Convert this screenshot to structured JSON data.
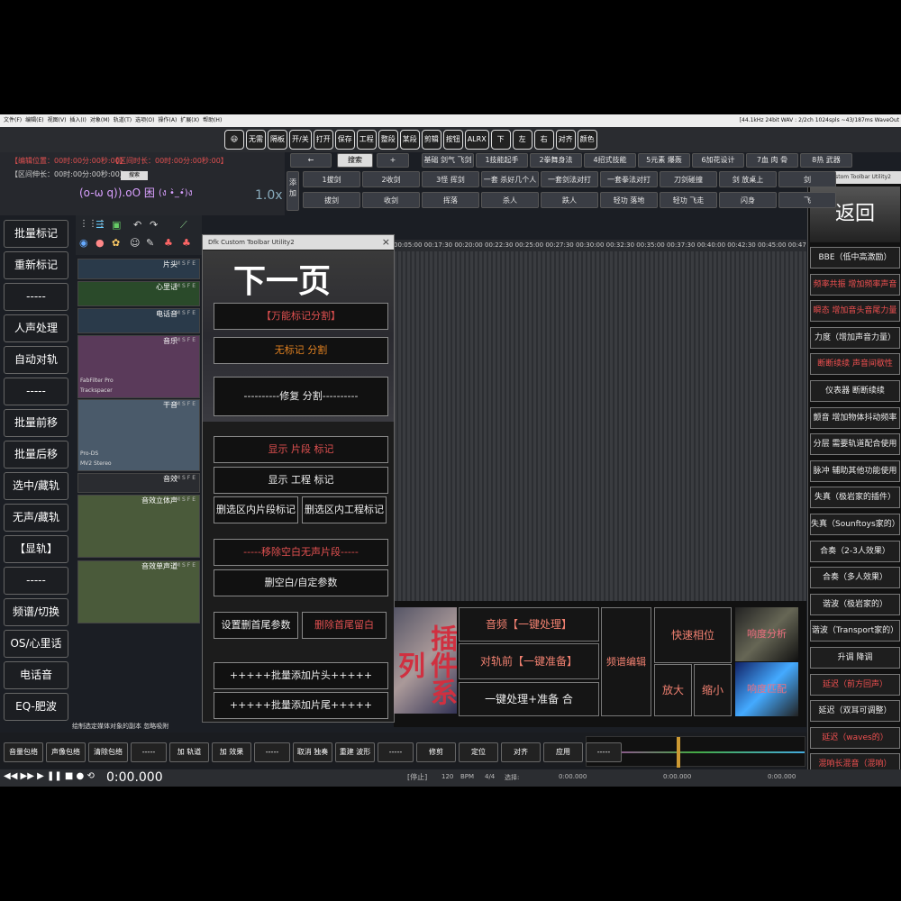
{
  "menu": {
    "items": [
      "文件(F)",
      "编辑(E)",
      "视图(V)",
      "插入(I)",
      "对象(M)",
      "轨道(T)",
      "选项(O)",
      "操作(A)",
      "扩展(X)",
      "帮助(H)"
    ],
    "status": "[44.1kHz 24bit WAV : 2/2ch 1024spls ~43/187ms WaveOut"
  },
  "toolbar": {
    "top_icons": [
      "😃",
      "无需",
      "隔板",
      "开/关",
      "打开",
      "保存",
      "工程",
      "整段",
      "某段",
      "剪辑",
      "按钮",
      "ALRX",
      "下",
      "左",
      "右",
      "对齐",
      "颜色"
    ],
    "back_arrow": "←",
    "search": "搜索",
    "plus": "+",
    "add_label": "添加",
    "zoom": "1.0x"
  },
  "info": {
    "edit_pos": "【编辑位置：00时:00分:00秒:00】",
    "range_len": "【区间时长：00时:00分:00秒:00】",
    "range_start": "【区间伸长：00时:00分:00秒:00】",
    "search_small": "搜索",
    "emote1": "(o-ω q)).oO 困",
    "emote2": "(ง •̀_•́)ง"
  },
  "tags_row1": [
    "基础 剑气 飞剑",
    "1技能起手",
    "2拳舞身法",
    "4招式技能",
    "5元素 爆轰",
    "6加花设计",
    "7血 肉 骨",
    "8热 武器"
  ],
  "tags_row2": [
    "1拔剑",
    "2收剑",
    "3怪 挥剑",
    "一套 杀好几个人",
    "一套剑法对打",
    "一套拳法对打",
    "刀剑碰撞",
    "剑 放桌上",
    "剑"
  ],
  "tags_row3": [
    "拔剑",
    "收剑",
    "挥落",
    "杀人",
    "跌人",
    "轻功 落地",
    "轻功 飞走",
    "闪身",
    "飞"
  ],
  "left_buttons": [
    "批量标记",
    "重新标记",
    "-----",
    "人声处理",
    "自动对轨",
    "-----",
    "批量前移",
    "批量后移",
    "选中/藏轨",
    "无声/藏轨",
    "【显轨】",
    "-----",
    "频谱/切换",
    "OS/心里话",
    "电话音",
    "EQ-肥波"
  ],
  "tracks": [
    {
      "name": "片头"
    },
    {
      "name": "心里话"
    },
    {
      "name": "电话音"
    },
    {
      "name": "音乐",
      "fx1": "FabFilter Pro",
      "fx2": "Trackspacer"
    },
    {
      "name": "干音",
      "fx1": "Pro-DS",
      "fx2": "MV2 Stereo"
    },
    {
      "name": "音效"
    },
    {
      "name": "音效立体声"
    },
    {
      "name": "音效单声道"
    }
  ],
  "hint": "绘制选定媒体对象的副本 忽略吸附",
  "ruler": "00:05:00 00:17:30 00:20:00 00:22:30 00:25:00 00:27:30 00:30:00 00:32:30 00:35:00 00:37:30 00:40:00 00:42:30 00:45:00 00:47:30 00:50:00 00:52:30",
  "dialog": {
    "title": "Dfk Custom Toolbar Utility2",
    "close": "×",
    "header": "下一页",
    "buttons": [
      "【万能标记分割】",
      "无标记 分割",
      "----------修复 分割----------",
      "显示 片段 标记",
      "显示 工程 标记",
      "删选区内片段标记",
      "删选区内工程标记",
      "-----移除空白无声片段-----",
      "删空白/自定参数",
      "设置删首尾参数",
      "删除首尾留白",
      "+++++批量添加片头+++++",
      "+++++批量添加片尾+++++"
    ]
  },
  "right_dialog": {
    "title": "Dfk Custom Toolbar Utility2",
    "back": "返回",
    "buttons": [
      "BBE（低中高激励）",
      "频率共振 增加频率声音",
      "瞬态 增加音头音尾力量",
      "力度（增加声音力量）",
      "断断续续 声音间歇性",
      "仪表器 断断续续",
      "颤音 增加物体抖动频率",
      "分层 需要轨道配合使用",
      "脉冲 辅助其他功能使用",
      "失真（极岩家的插件）",
      "失真（Sounftoys家的）",
      "合奏（2-3人效果）",
      "合奏（多人效果）",
      "谐波（极岩家的）",
      "谐波（Transport家的）",
      "升调 降调",
      "延迟（前方回声）",
      "延迟（双耳可调整）",
      "延迟（waves的）",
      "混响长混音（混响）",
      "混响长混音（混响）"
    ]
  },
  "panel": {
    "plugin_art": "插件系列",
    "audio_btn": "音频【一键处理】",
    "align_btn": "对轨前【一键准备】",
    "combo_btn": "一键处理+准备 合",
    "spectrum_btn": "频谱编辑",
    "phase_btn": "快速相位",
    "zoom_in": "放大",
    "zoom_out": "缩小",
    "anime1": "响度分析",
    "anime2": "响度匹配"
  },
  "bottom": [
    "音量包络",
    "声像包络",
    "清除包络",
    "-----",
    "加 轨道",
    "加 效果",
    "-----",
    "取消 独奏",
    "重建 波形",
    "-----",
    "修剪",
    "定位",
    "对齐",
    "应用",
    "-----"
  ],
  "transport": {
    "time": "0:00.000",
    "status": "[停止]",
    "bpm": "120",
    "bpm_label": "BPM",
    "sig": "4/4",
    "sel_label": "选择:",
    "sel_start": "0:00.000",
    "sel_end": "0:00.000",
    "sel_len": "0:00.000"
  }
}
